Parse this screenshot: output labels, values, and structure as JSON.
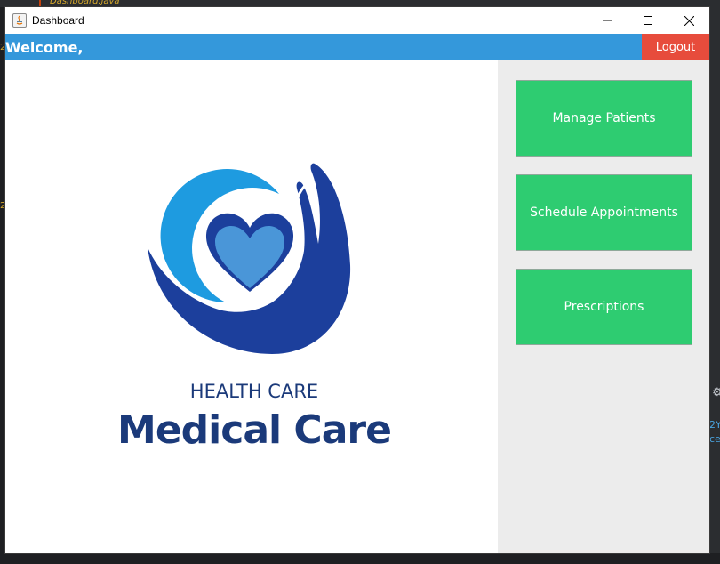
{
  "background": {
    "ide_tab": "Dashboard.java",
    "left_line_number": "2",
    "right_text": [
      "2Y",
      "ce"
    ]
  },
  "window": {
    "title": "Dashboard",
    "controls": {
      "minimize_icon": "minimize-icon",
      "maximize_icon": "maximize-icon",
      "close_icon": "close-icon"
    }
  },
  "header": {
    "welcome_text": "Welcome,",
    "logout_label": "Logout",
    "bg_color": "#3498db",
    "logout_color": "#e74c3c"
  },
  "logo": {
    "subtitle": "HEALTH CARE",
    "title": "Medical Care"
  },
  "sidebar": {
    "buttons": [
      {
        "label": "Manage Patients"
      },
      {
        "label": "Schedule Appointments"
      },
      {
        "label": "Prescriptions"
      }
    ],
    "button_color": "#2ecc71"
  }
}
